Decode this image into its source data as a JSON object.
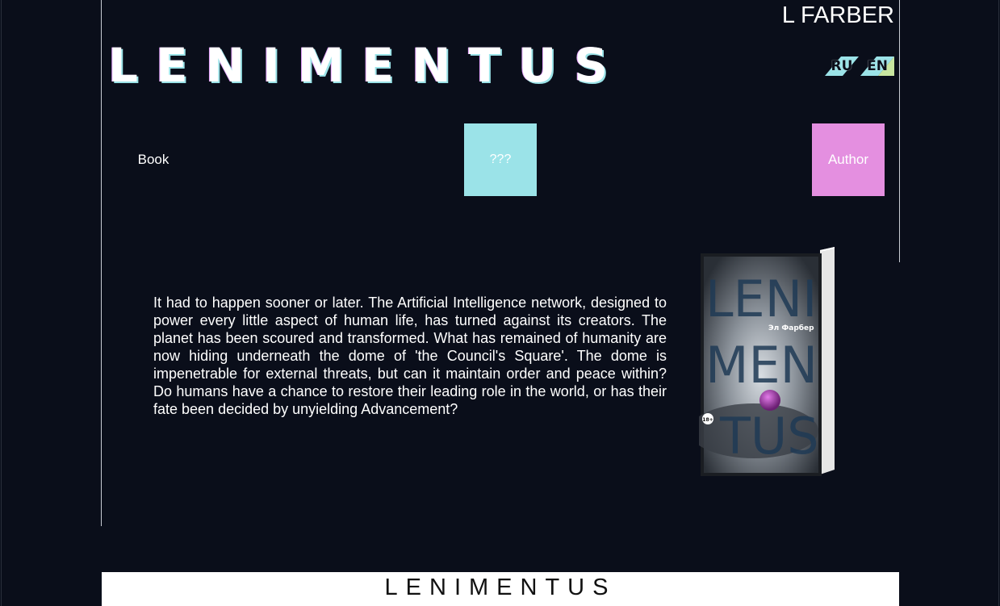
{
  "header": {
    "author_name": "L FARBER",
    "logo": "LENIMENTUS"
  },
  "languages": [
    {
      "label": "RU",
      "color": "#9be3e8"
    },
    {
      "label": "EN",
      "color": "#c8e6a0"
    }
  ],
  "nav": {
    "book": "Book",
    "mystery": "???",
    "author": "Author"
  },
  "main": {
    "description": "It had to happen sooner or later. The Artificial Intelligence network, designed to power every little aspect of human life, has turned against its creators. The planet has been scoured and transformed. What has remained of humanity are now hiding underneath the dome of 'the Council's Square'. The dome is impenetrable for external threats, but can it maintain order and peace within? Do humans have a chance to restore their leading role in the world, or has their fate been decided by unyielding Advancement?",
    "cover": {
      "author": "Эл Фарбер",
      "title_lines": [
        "LENI",
        "MEN",
        "TUS"
      ],
      "age_rating": "18+"
    }
  },
  "footer": {
    "title": "LENIMENTUS"
  },
  "colors": {
    "background": "#0a0e1a",
    "accent_cyan": "#9be3e8",
    "accent_pink": "#e48fe0",
    "accent_green": "#c8e6a0"
  }
}
